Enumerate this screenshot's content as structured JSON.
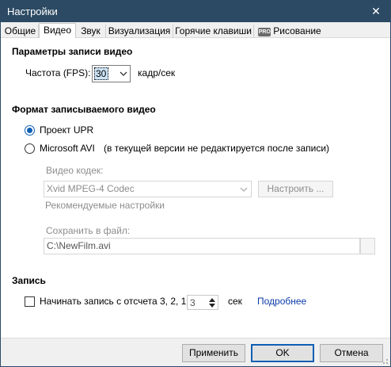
{
  "window": {
    "title": "Настройки",
    "close_glyph": "✕"
  },
  "tabs": [
    {
      "label": "Общие"
    },
    {
      "label": "Видео",
      "active": true
    },
    {
      "label": "Звук"
    },
    {
      "label": "Визуализация"
    },
    {
      "label": "Горячие клавиши"
    },
    {
      "label": "Рисование",
      "badge": "PRO"
    }
  ],
  "video_params": {
    "heading": "Параметры записи видео",
    "fps_label": "Частота (FPS):",
    "fps_value": "30",
    "fps_unit": "кадр/сек"
  },
  "format": {
    "heading": "Формат записываемого видео",
    "option_upr": "Проект UPR",
    "option_avi": "Microsoft AVI",
    "avi_note": "(в текущей версии не редактируется после записи)",
    "selected": "upr",
    "codec_label": "Видео кодек:",
    "codec_value": "Xvid MPEG-4 Codec",
    "configure_button": "Настроить ...",
    "recommended_link": "Рекомендуемые настройки",
    "save_label": "Сохранить в файл:",
    "save_value": "C:\\NewFilm.avi"
  },
  "recording": {
    "heading": "Запись",
    "countdown_label": "Начинать запись с отсчета 3, 2, 1",
    "countdown_checked": false,
    "seconds_value": "3",
    "seconds_unit": "сек",
    "more_link": "Подробнее"
  },
  "buttons": {
    "apply": "Применить",
    "ok": "OK",
    "cancel": "Отмена"
  },
  "colors": {
    "titlebar": "#2c4a63",
    "accent": "#0f5fb4",
    "link": "#0b39a8",
    "disabled_text": "#8d8d8d"
  },
  "icons": {
    "close": "close-icon",
    "fps_dropdown": "chevron-down-icon",
    "codec_dropdown": "chevron-down-icon",
    "spin_up": "arrow-up-icon",
    "spin_down": "arrow-down-icon",
    "resize": "resize-grip-icon"
  }
}
